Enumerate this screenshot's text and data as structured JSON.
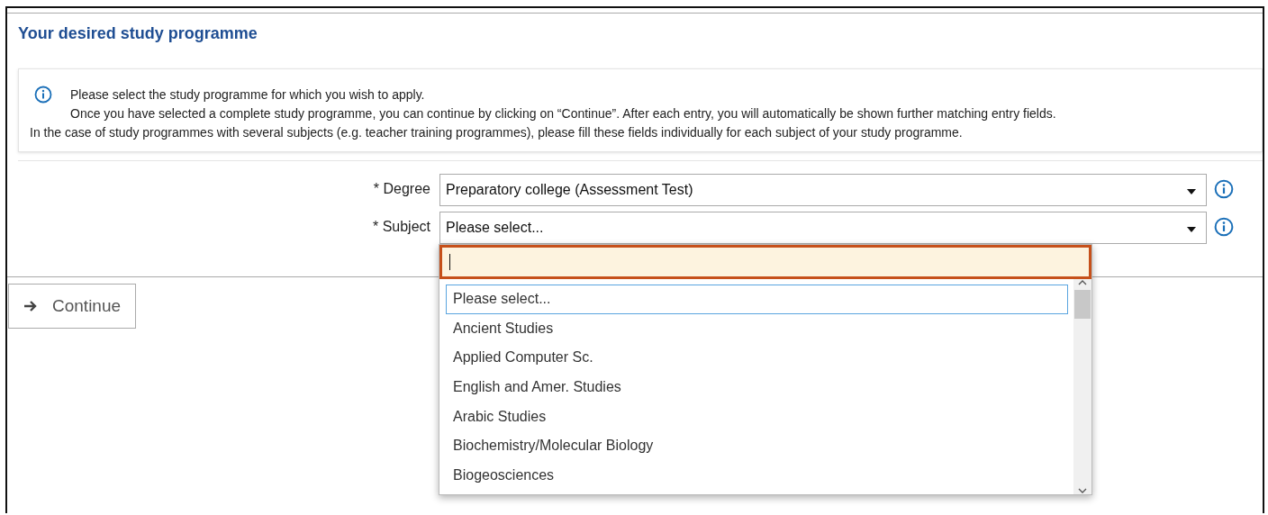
{
  "title": "Your desired study programme",
  "info": {
    "lines": [
      "Please select the study programme for which you wish to apply.",
      "Once you have selected a complete study programme, you can continue by clicking on “Continue”. After each entry, you will automatically be shown further matching entry fields.",
      "In the case of study programmes with several subjects (e.g. teacher training programmes), please fill these fields individually for each subject of your study programme."
    ]
  },
  "fields": [
    {
      "label": "* Degree",
      "value": "Preparatory college (Assessment Test)",
      "expanded": false
    },
    {
      "label": "* Subject",
      "value": "Please select...",
      "expanded": true
    }
  ],
  "dropdown": {
    "options": [
      {
        "label": "Please select...",
        "selected": true
      },
      {
        "label": "Ancient Studies",
        "selected": false
      },
      {
        "label": "Applied Computer Sc.",
        "selected": false
      },
      {
        "label": "English and Amer. Studies",
        "selected": false
      },
      {
        "label": "Arabic Studies",
        "selected": false
      },
      {
        "label": "Biochemistry/Molecular Biology",
        "selected": false
      },
      {
        "label": "Biogeosciences",
        "selected": false
      }
    ]
  },
  "continue_button": "Continue"
}
